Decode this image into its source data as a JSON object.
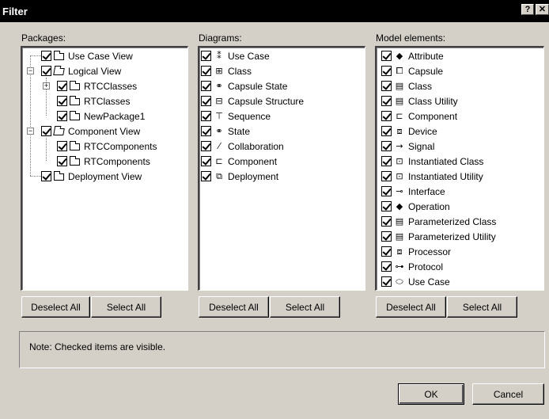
{
  "window": {
    "title": "Filter",
    "help_btn": "?",
    "close_btn": "✕"
  },
  "packages": {
    "label": "Packages:",
    "items": [
      {
        "label": "Use Case View",
        "icon": "folder-icon"
      },
      {
        "label": "Logical View",
        "icon": "open-folder-icon"
      },
      {
        "label": "RTCClasses",
        "icon": "package-icon"
      },
      {
        "label": "RTClasses",
        "icon": "package-icon"
      },
      {
        "label": "NewPackage1",
        "icon": "package-icon"
      },
      {
        "label": "Component View",
        "icon": "open-folder-icon"
      },
      {
        "label": "RTCComponents",
        "icon": "package-icon"
      },
      {
        "label": "RTComponents",
        "icon": "package-icon"
      },
      {
        "label": "Deployment View",
        "icon": "folder-icon"
      }
    ],
    "deselect_all": "Deselect All",
    "select_all": "Select All"
  },
  "diagrams": {
    "label": "Diagrams:",
    "items": [
      {
        "label": "Use Case",
        "icon": "use-case-diagram-icon"
      },
      {
        "label": "Class",
        "icon": "class-diagram-icon"
      },
      {
        "label": "Capsule State",
        "icon": "capsule-state-icon"
      },
      {
        "label": "Capsule Structure",
        "icon": "capsule-structure-icon"
      },
      {
        "label": "Sequence",
        "icon": "sequence-icon"
      },
      {
        "label": "State",
        "icon": "state-icon"
      },
      {
        "label": "Collaboration",
        "icon": "collaboration-icon"
      },
      {
        "label": "Component",
        "icon": "component-icon"
      },
      {
        "label": "Deployment",
        "icon": "deployment-icon"
      }
    ],
    "deselect_all": "Deselect All",
    "select_all": "Select All"
  },
  "model_elements": {
    "label": "Model elements:",
    "items": [
      {
        "label": "Attribute",
        "icon": "attribute-icon"
      },
      {
        "label": "Capsule",
        "icon": "capsule-icon"
      },
      {
        "label": "Class",
        "icon": "class-icon"
      },
      {
        "label": "Class Utility",
        "icon": "class-utility-icon"
      },
      {
        "label": "Component",
        "icon": "component-icon"
      },
      {
        "label": "Device",
        "icon": "device-icon"
      },
      {
        "label": "Signal",
        "icon": "signal-icon"
      },
      {
        "label": "Instantiated Class",
        "icon": "instantiated-class-icon"
      },
      {
        "label": "Instantiated Utility",
        "icon": "instantiated-utility-icon"
      },
      {
        "label": "Interface",
        "icon": "interface-icon"
      },
      {
        "label": "Operation",
        "icon": "operation-icon"
      },
      {
        "label": "Parameterized Class",
        "icon": "parameterized-class-icon"
      },
      {
        "label": "Parameterized Utility",
        "icon": "parameterized-utility-icon"
      },
      {
        "label": "Processor",
        "icon": "processor-icon"
      },
      {
        "label": "Protocol",
        "icon": "protocol-icon"
      },
      {
        "label": "Use Case",
        "icon": "use-case-icon"
      }
    ],
    "deselect_all": "Deselect All",
    "select_all": "Select All"
  },
  "note": "Note: Checked items are visible.",
  "ok": "OK",
  "cancel": "Cancel"
}
